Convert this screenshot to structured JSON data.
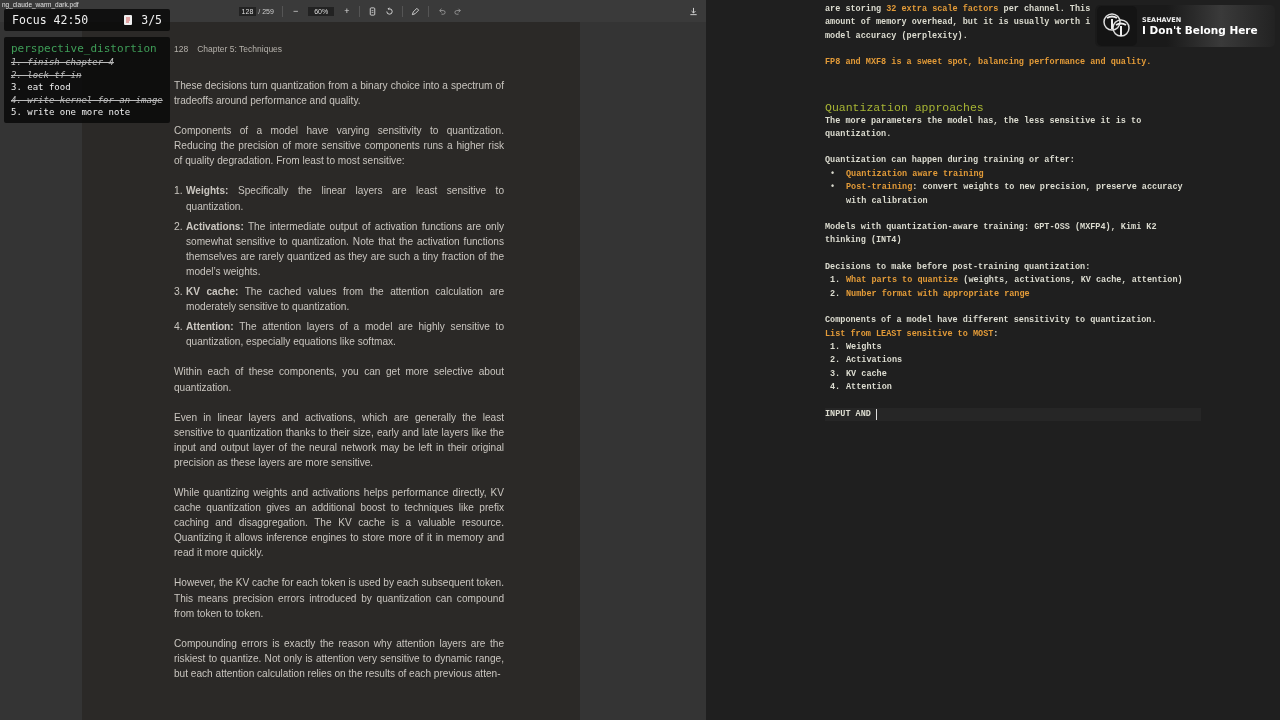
{
  "pdf_viewer": {
    "toolbar": {
      "filename": "ng_claude_warm_dark.pdf",
      "page": "128",
      "page_total": "/ 259",
      "zoom_out": "−",
      "zoom": "60%",
      "zoom_in": "+"
    },
    "page": {
      "header_number": "128",
      "header_title": "Chapter 5: Techniques",
      "blocks": [
        {
          "kind": "para",
          "text": "These decisions turn quantization from a binary choice into a spectrum of tradeoffs around performance and quality."
        },
        {
          "kind": "para",
          "text": "Components of a model have varying sensitivity to quantization. Reducing the precision of more sensitive components runs a higher risk of quality degradation. From least to most sensitive:"
        },
        {
          "kind": "list",
          "items": [
            {
              "number": "1.",
              "text": "**Weights:** Specifically the linear layers are least sensitive to quantization."
            },
            {
              "number": "2.",
              "text": "**Activations:** The intermediate output of activation functions are only somewhat sensitive to quantization. Note that the activation functions themselves are rarely quantized as they are such a tiny fraction of the model’s weights."
            },
            {
              "number": "3.",
              "text": "**KV cache:** The cached values from the attention calculation are moderately sensitive to quantization."
            },
            {
              "number": "4.",
              "text": "**Attention:** The attention layers of a model are highly sensitive to quantization, especially equations like softmax."
            }
          ]
        },
        {
          "kind": "para",
          "text": "Within each of these components, you can get more selective about quantization."
        },
        {
          "kind": "para",
          "text": "Even in linear layers and activations, which are generally the least sensitive to quantization thanks to their size, early and late layers like the input and output layer of the neural network may be left in their original precision as these layers are more sensitive."
        },
        {
          "kind": "para",
          "text": "While quantizing weights and activations helps performance directly, KV cache quantization gives an additional boost to techniques like prefix caching and disaggregation. The KV cache is a valuable resource. Quantizing it allows inference engines to store more of it in memory and read it more quickly."
        },
        {
          "kind": "para",
          "text": "However, the KV cache for each token is used by each subsequent token. This means precision errors introduced by quantization can compound from token to token."
        },
        {
          "kind": "para",
          "text": "Compounding errors is exactly the reason why attention layers are the riskiest to quantize. Not only is attention very sensitive to dynamic range, but each attention calculation relies on the results of each previous atten-"
        }
      ]
    }
  },
  "editor": {
    "blocks": [
      {
        "kind": "lines",
        "lines": [
          "are storing **32 extra scale factors** per channel. This",
          "amount of memory overhead, but it is usually worth i",
          "model accuracy (perplexity)."
        ]
      },
      {
        "kind": "callout",
        "lines": [
          "FP8 and MXF8 is a sweet spot, balancing performance and quality."
        ]
      },
      {
        "kind": "heading",
        "text": "Quantization approaches"
      },
      {
        "kind": "lines",
        "lines": [
          "The more parameters the model has, the less sensitive it is to quantization."
        ]
      },
      {
        "kind": "list",
        "lines": [
          "Quantization can happen during training or after:"
        ],
        "items": [
          {
            "marker": "•",
            "text": "**Quantization aware training**"
          },
          {
            "marker": "•",
            "text": "**Post-training**: convert weights to new precision, preserve accuracy with calibration"
          }
        ]
      },
      {
        "kind": "lines",
        "lines": [
          "Models with quantization-aware training: GPT-OSS (MXFP4), Kimi K2 thinking (INT4)"
        ]
      },
      {
        "kind": "list",
        "lines": [
          "Decisions to make before post-training quantization:"
        ],
        "items": [
          {
            "marker": "1.",
            "text": "**What parts to quantize** (weights, activations, KV cache, attention)"
          },
          {
            "marker": "2.",
            "text": "**Number format with appropriate range**"
          }
        ]
      },
      {
        "kind": "list",
        "lines": [
          "Components of a model have different sensitivity to quantization.",
          "**List from LEAST sensitive to MOST**:"
        ],
        "items": [
          {
            "marker": "1.",
            "text": "Weights"
          },
          {
            "marker": "2.",
            "text": "Activations"
          },
          {
            "marker": "3.",
            "text": "KV cache"
          },
          {
            "marker": "4.",
            "text": "Attention"
          }
        ]
      },
      {
        "kind": "input",
        "text": "INPUT AND"
      }
    ]
  },
  "focus_widget": {
    "title": "Focus 42:50",
    "count": "3/5",
    "project": "perspective_distortion",
    "tasks": [
      {
        "text": "1. finish chapter 4",
        "done": true
      },
      {
        "text": "2. lock tf in",
        "done": true
      },
      {
        "text": "3. eat food",
        "done": false
      },
      {
        "text": "4. write kernel for an image",
        "done": true
      },
      {
        "text": "5. write one more note",
        "done": false
      }
    ]
  },
  "now_playing": {
    "artist": "SEAHAVEN",
    "track": "I Don't Belong Here"
  }
}
